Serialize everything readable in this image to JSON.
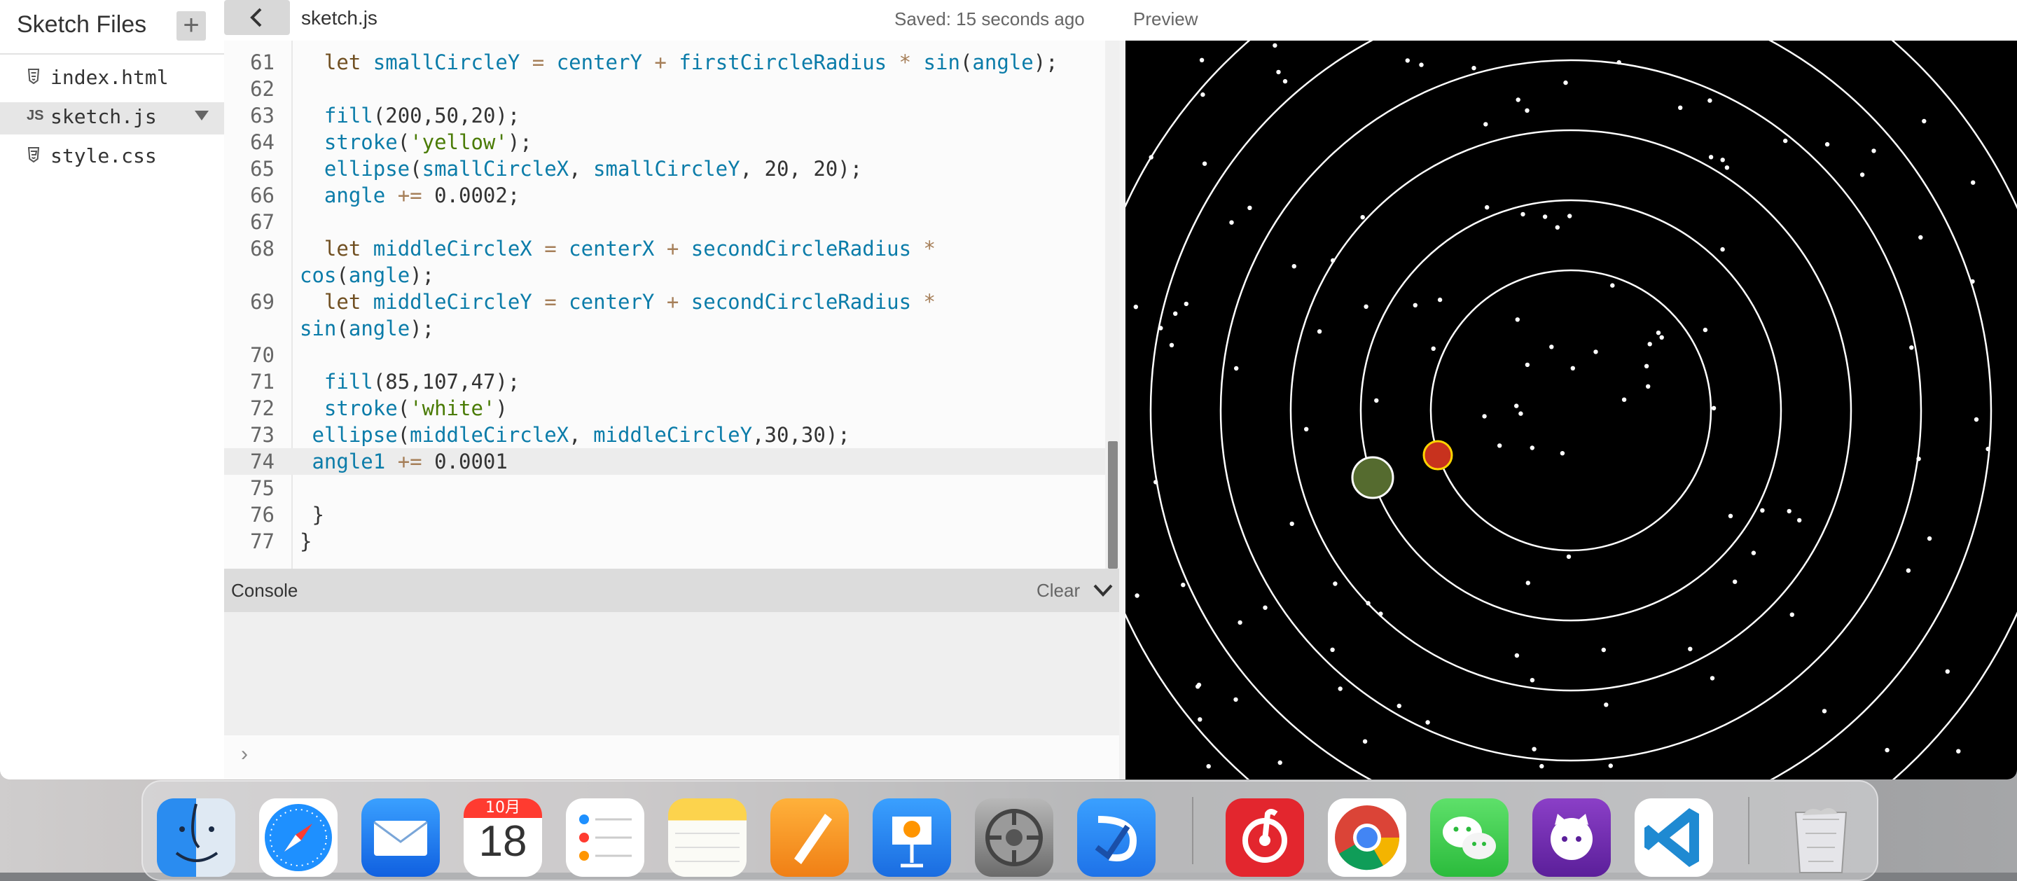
{
  "sidebar": {
    "title": "Sketch Files",
    "add_icon": "plus-icon",
    "files": [
      {
        "icon": "html5-icon",
        "name": "index.html",
        "active": false
      },
      {
        "icon": "js-icon",
        "icon_label": "JS",
        "name": "sketch.js",
        "active": true
      },
      {
        "icon": "css3-icon",
        "name": "style.css",
        "active": false
      }
    ]
  },
  "topbar": {
    "collapse_icon": "chevron-left-icon",
    "file_title": "sketch.js",
    "saved_status": "Saved: 15 seconds ago",
    "preview_label": "Preview"
  },
  "editor": {
    "lines": [
      {
        "n": "61",
        "text": "  let smallCircleY = centerY + firstCircleRadius * sin(angle);"
      },
      {
        "n": "62",
        "text": ""
      },
      {
        "n": "63",
        "text": "  fill(200,50,20);"
      },
      {
        "n": "64",
        "text": "  stroke('yellow');"
      },
      {
        "n": "65",
        "text": "  ellipse(smallCircleX, smallCircleY, 20, 20);"
      },
      {
        "n": "66",
        "text": "  angle += 0.0002;"
      },
      {
        "n": "67",
        "text": ""
      },
      {
        "n": "68",
        "text": "  let middleCircleX = centerX + secondCircleRadius *"
      },
      {
        "n": "",
        "text": "cos(angle);"
      },
      {
        "n": "69",
        "text": "  let middleCircleY = centerY + secondCircleRadius *"
      },
      {
        "n": "",
        "text": "sin(angle);"
      },
      {
        "n": "70",
        "text": ""
      },
      {
        "n": "71",
        "text": "  fill(85,107,47);"
      },
      {
        "n": "72",
        "text": "  stroke('white')"
      },
      {
        "n": "73",
        "text": " ellipse(middleCircleX, middleCircleY,30,30);"
      },
      {
        "n": "74",
        "text": " angle1 += 0.0001"
      },
      {
        "n": "75",
        "text": ""
      },
      {
        "n": "76",
        "text": " }"
      },
      {
        "n": "77",
        "text": "}"
      }
    ],
    "current_line": "74"
  },
  "console": {
    "title": "Console",
    "clear_label": "Clear",
    "prompt": "›"
  },
  "preview": {
    "background": "#000000",
    "ring_color": "#ffffff",
    "red_circle_color": "#c8321e",
    "red_circle_stroke": "#ffd400",
    "green_circle_color": "#556b2f",
    "green_circle_stroke": "#ffffff"
  },
  "dock": {
    "calendar_month": "10月",
    "calendar_day": "18",
    "apps": [
      "finder-icon",
      "safari-icon",
      "mail-icon",
      "calendar-icon",
      "reminders-icon",
      "notes-icon",
      "pages-icon",
      "keynote-icon",
      "system-settings-icon",
      "lark-icon",
      "netease-music-icon",
      "chrome-icon",
      "wechat-icon",
      "github-desktop-icon",
      "vscode-icon",
      "trash-icon"
    ]
  }
}
